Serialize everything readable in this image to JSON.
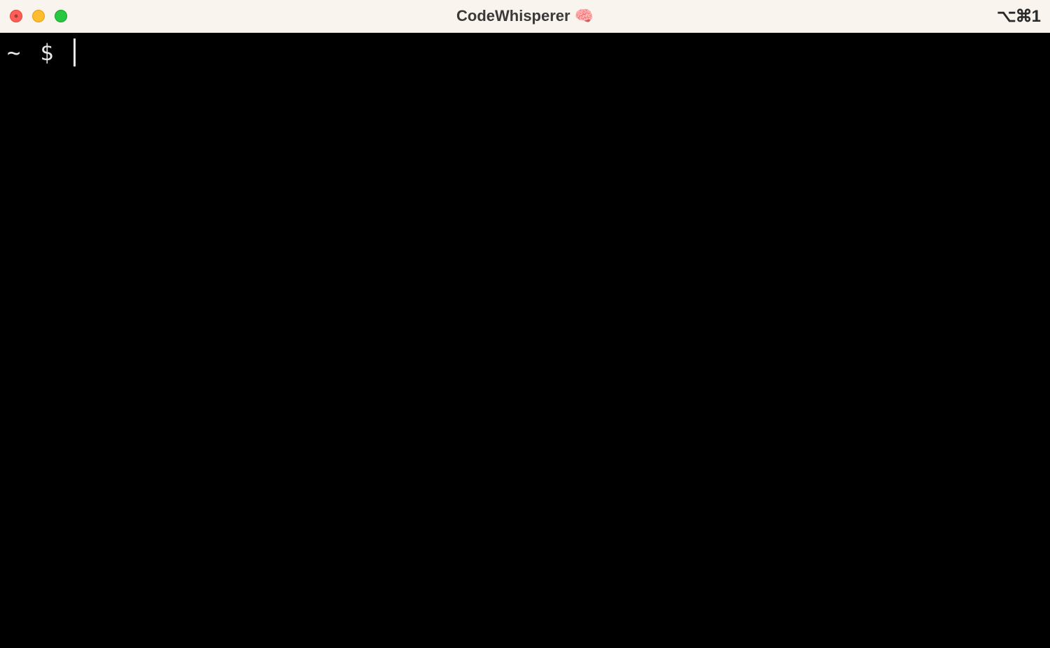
{
  "titlebar": {
    "title": "CodeWhisperer",
    "title_emoji": "🧠",
    "shortcut": "⌥⌘1"
  },
  "terminal": {
    "prompt_path": "~",
    "prompt_symbol": "$",
    "input": ""
  },
  "colors": {
    "titlebar_bg": "#faf4ee",
    "terminal_bg": "#000000",
    "terminal_fg": "#e8e8e8",
    "close": "#ff5f57",
    "minimize": "#febc2e",
    "maximize": "#28c840"
  }
}
